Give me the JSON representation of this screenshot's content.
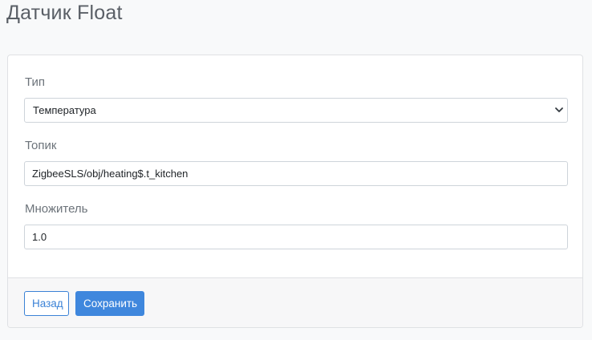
{
  "page": {
    "title": "Датчик Float"
  },
  "form": {
    "type": {
      "label": "Тип",
      "selected": "Температура"
    },
    "topic": {
      "label": "Топик",
      "value": "ZigbeeSLS/obj/heating$.t_kitchen"
    },
    "multiplier": {
      "label": "Множитель",
      "value": "1.0"
    }
  },
  "footer": {
    "back_label": "Назад",
    "save_label": "Сохранить"
  },
  "colors": {
    "accent": "#3f87dd",
    "border": "#ced4da",
    "background": "#f8f9fa"
  }
}
